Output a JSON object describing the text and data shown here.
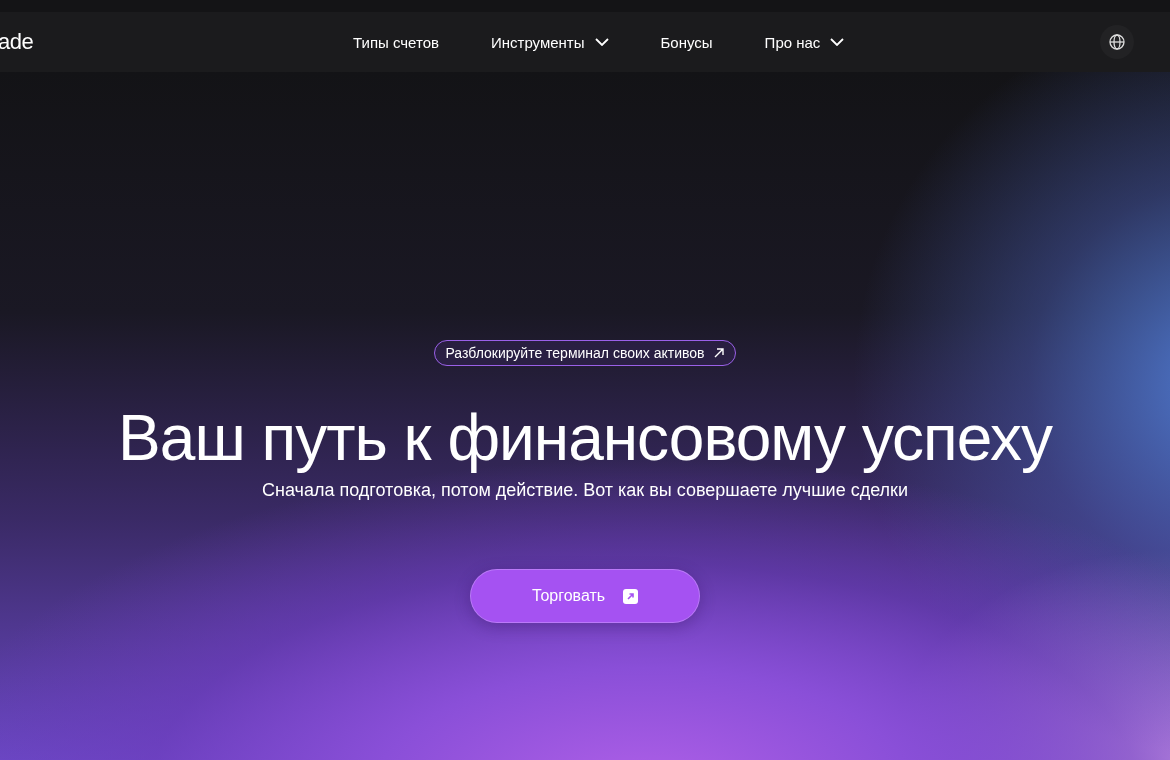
{
  "header": {
    "logo": "ade",
    "nav": [
      {
        "label": "Типы счетов",
        "dropdown": false
      },
      {
        "label": "Инструменты",
        "dropdown": true
      },
      {
        "label": "Бонусы",
        "dropdown": false
      },
      {
        "label": "Про нас",
        "dropdown": true
      }
    ]
  },
  "hero": {
    "badge": "Разблокируйте терминал своих активов",
    "title": "Ваш путь к финансовому успеху",
    "subtitle": "Сначала подготовка, потом действие. Вот как вы совершаете лучшие сделки",
    "cta": "Торговать"
  }
}
